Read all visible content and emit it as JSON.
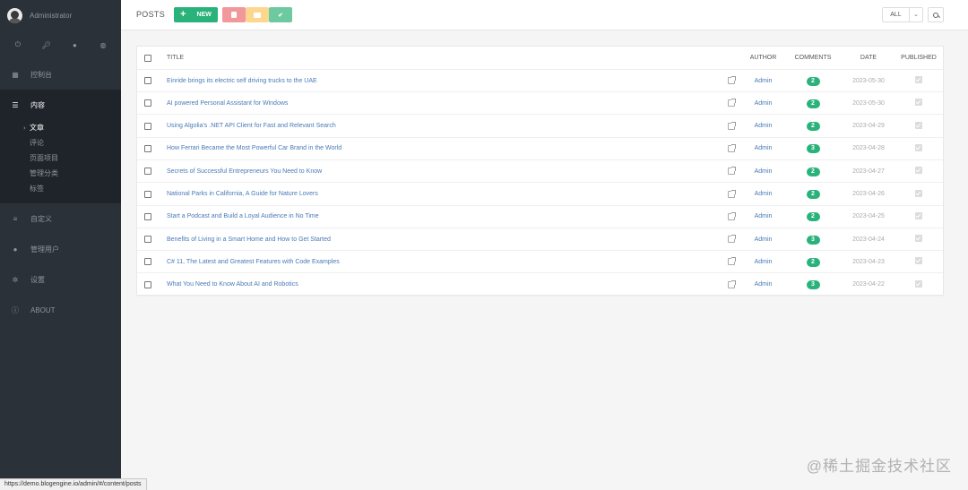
{
  "user": {
    "name": "Administrator"
  },
  "nav": {
    "dashboard": "控制台",
    "content": "内容",
    "content_items": [
      "文章",
      "评论",
      "页面项目",
      "管理分类",
      "标签"
    ],
    "custom": "自定义",
    "users": "管理用户",
    "settings": "设置",
    "about": "ABOUT"
  },
  "toolbar": {
    "title": "POSTS",
    "new_label": "NEW",
    "filter_value": "ALL",
    "colors": {
      "new": "#2ab27b",
      "delete": "#f0989a",
      "draft": "#fdd68f",
      "publish": "#6cc9a0"
    }
  },
  "table": {
    "headers": {
      "title": "TITLE",
      "author": "AUTHOR",
      "comments": "COMMENTS",
      "date": "DATE",
      "published": "PUBLISHED"
    },
    "rows": [
      {
        "title": "Einride brings its electric self driving trucks to the UAE",
        "author": "Admin",
        "comments": "2",
        "date": "2023-05-30",
        "published": true
      },
      {
        "title": "AI powered Personal Assistant for Windows",
        "author": "Admin",
        "comments": "2",
        "date": "2023-05-30",
        "published": true
      },
      {
        "title": "Using Algolia's .NET API Client for Fast and Relevant Search",
        "author": "Admin",
        "comments": "2",
        "date": "2023-04-29",
        "published": true
      },
      {
        "title": "How Ferrari Became the Most Powerful Car Brand in the World",
        "author": "Admin",
        "comments": "3",
        "date": "2023-04-28",
        "published": true
      },
      {
        "title": "Secrets of Successful Entrepreneurs You Need to Know",
        "author": "Admin",
        "comments": "2",
        "date": "2023-04-27",
        "published": true
      },
      {
        "title": "National Parks in California, A Guide for Nature Lovers",
        "author": "Admin",
        "comments": "2",
        "date": "2023-04-26",
        "published": true
      },
      {
        "title": "Start a Podcast and Build a Loyal Audience in No Time",
        "author": "Admin",
        "comments": "2",
        "date": "2023-04-25",
        "published": true
      },
      {
        "title": "Benefits of Living in a Smart Home and How to Get Started",
        "author": "Admin",
        "comments": "3",
        "date": "2023-04-24",
        "published": true
      },
      {
        "title": "C# 11, The Latest and Greatest Features with Code Examples",
        "author": "Admin",
        "comments": "2",
        "date": "2023-04-23",
        "published": true
      },
      {
        "title": "What You Need to Know About AI and Robotics",
        "author": "Admin",
        "comments": "3",
        "date": "2023-04-22",
        "published": true
      }
    ]
  },
  "status_url": "https://demo.blogengine.io/admin/#/content/posts",
  "watermark": "@稀土掘金技术社区"
}
